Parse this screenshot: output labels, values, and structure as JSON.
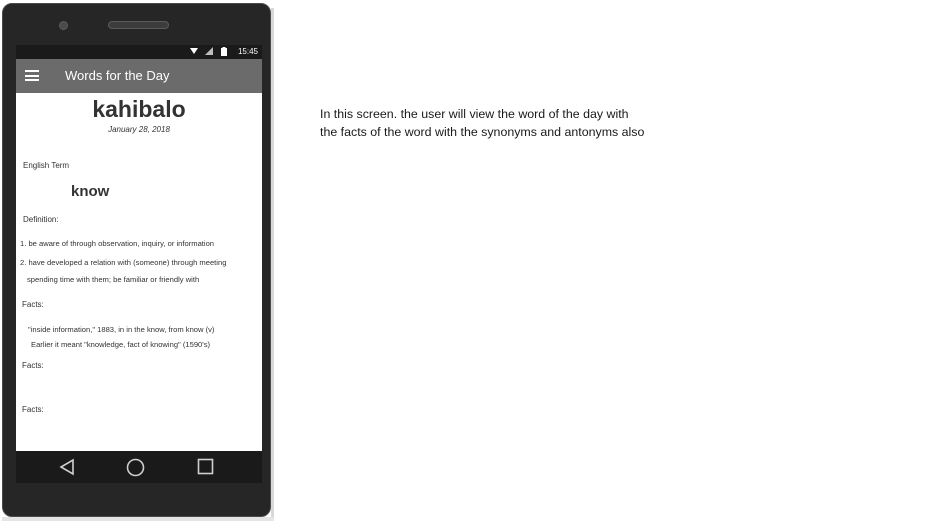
{
  "status": {
    "wifi_icon": "wifi-icon",
    "signal_icon": "signal-icon",
    "battery_icon": "battery-icon",
    "time": "15:45"
  },
  "appbar": {
    "menu_icon": "hamburger-menu-icon",
    "title": "Words for the Day"
  },
  "word_of_day": {
    "word": "kahibalo",
    "date": "January 28, 2018",
    "english_term_label": "English Term",
    "english_term": "know",
    "definition_label": "Definition:",
    "definitions": [
      "1. be aware of through observation, inquiry, or information",
      "2. have developed a relation with (someone) through meeting",
      "spending time with them; be familiar or friendly with"
    ],
    "facts_label_1": "Facts:",
    "facts_text": [
      "\"inside information,\" 1883, in in the know, from know (v)",
      "Earlier it meant \"knowledge, fact of knowing\" (1590's)"
    ],
    "facts_label_2": "Facts:",
    "facts_label_3": "Facts:"
  },
  "navbar": {
    "back_icon": "back-triangle-icon",
    "home_icon": "home-circle-icon",
    "recents_icon": "recents-square-icon"
  },
  "note": {
    "line1": "In this screen. the user will view the word of the day with",
    "line2": "the facts of the word with the synonyms and antonyms also"
  }
}
